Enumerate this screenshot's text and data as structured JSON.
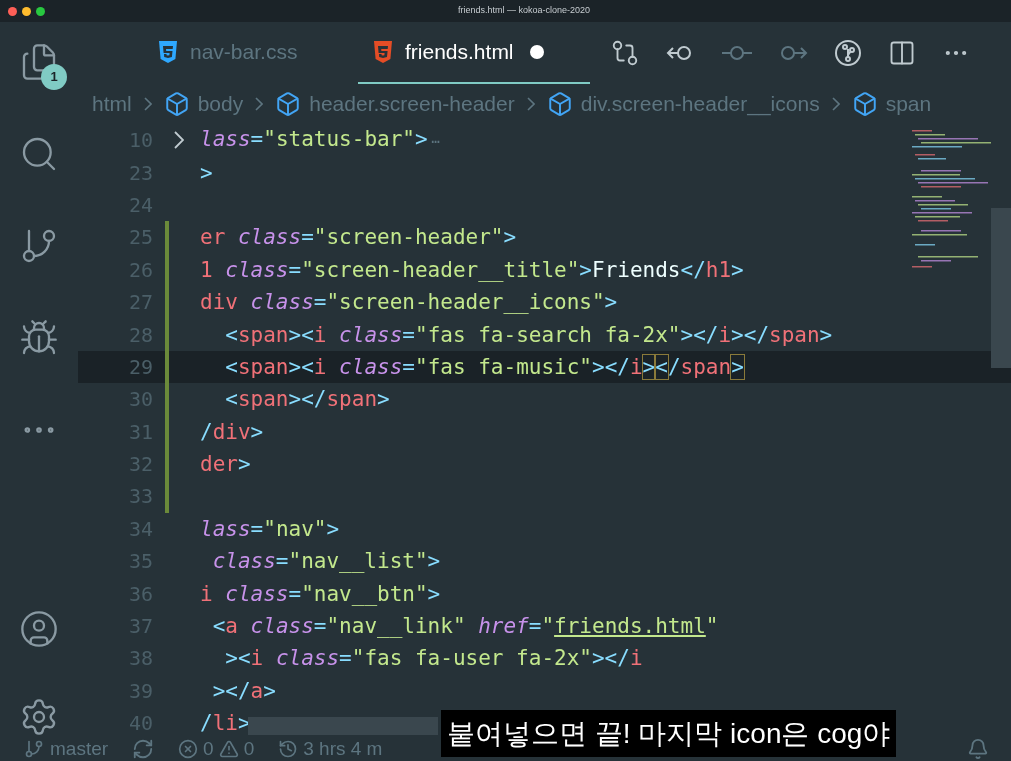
{
  "window": {
    "title": "friends.html — kokoa-clone-2020"
  },
  "activity_bar": {
    "items": [
      {
        "kind": "files",
        "badge": "1"
      },
      {
        "kind": "search"
      },
      {
        "kind": "git"
      },
      {
        "kind": "debug"
      },
      {
        "kind": "more"
      }
    ],
    "bottom": [
      {
        "kind": "account"
      },
      {
        "kind": "settings"
      }
    ]
  },
  "tabs": [
    {
      "label": "nav-bar.css",
      "kind": "css",
      "selected": false,
      "dirty": false
    },
    {
      "label": "friends.html",
      "kind": "html",
      "selected": true,
      "dirty": true
    }
  ],
  "breadcrumbs": [
    {
      "label": "html",
      "kind": "plain"
    },
    {
      "label": "body",
      "kind": "element"
    },
    {
      "label": "header.screen-header",
      "kind": "element"
    },
    {
      "label": "div.screen-header__icons",
      "kind": "element"
    },
    {
      "label": "span",
      "kind": "element"
    }
  ],
  "lines": [
    {
      "number": "10",
      "folded": true,
      "modified": false,
      "current": false,
      "tokens": [
        {
          "kind": "attr",
          "text": "lass"
        },
        {
          "kind": "punct",
          "text": "="
        },
        {
          "kind": "string",
          "text": "\"status-bar\""
        },
        {
          "kind": "punct",
          "text": ">"
        },
        {
          "kind": "ellipsis",
          "text": "⋯"
        }
      ]
    },
    {
      "number": "23",
      "folded": false,
      "modified": false,
      "current": false,
      "tokens": [
        {
          "kind": "punct",
          "text": ">"
        }
      ]
    },
    {
      "number": "24",
      "folded": false,
      "modified": false,
      "current": false
    },
    {
      "number": "25",
      "folded": false,
      "modified": true,
      "current": false,
      "tokens": [
        {
          "kind": "tag",
          "text": "er"
        },
        {
          "kind": "attr",
          "text": " class"
        },
        {
          "kind": "punct",
          "text": "="
        },
        {
          "kind": "string",
          "text": "\"screen-header\""
        },
        {
          "kind": "punct",
          "text": ">"
        }
      ]
    },
    {
      "number": "26",
      "folded": false,
      "modified": true,
      "current": false,
      "tokens": [
        {
          "kind": "tag",
          "text": "1"
        },
        {
          "kind": "attr",
          "text": " class"
        },
        {
          "kind": "punct",
          "text": "="
        },
        {
          "kind": "string",
          "text": "\"screen-header__title\""
        },
        {
          "kind": "punct",
          "text": ">"
        },
        {
          "kind": "text",
          "text": "Friends"
        },
        {
          "kind": "punct",
          "text": "</"
        },
        {
          "kind": "tag",
          "text": "h1"
        },
        {
          "kind": "punct",
          "text": ">"
        }
      ]
    },
    {
      "number": "27",
      "folded": false,
      "modified": true,
      "current": false,
      "tokens": [
        {
          "kind": "tag",
          "text": "div"
        },
        {
          "kind": "attr",
          "text": " class"
        },
        {
          "kind": "punct",
          "text": "="
        },
        {
          "kind": "string",
          "text": "\"screen-header__icons\""
        },
        {
          "kind": "punct",
          "text": ">"
        }
      ]
    },
    {
      "number": "28",
      "folded": false,
      "modified": true,
      "current": false,
      "tokens": [
        {
          "kind": "punct",
          "text": "  <"
        },
        {
          "kind": "tag",
          "text": "span"
        },
        {
          "kind": "punct",
          "text": "><"
        },
        {
          "kind": "tag",
          "text": "i"
        },
        {
          "kind": "attr",
          "text": " class"
        },
        {
          "kind": "punct",
          "text": "="
        },
        {
          "kind": "string",
          "text": "\"fas fa-search fa-2x\""
        },
        {
          "kind": "punct",
          "text": "></"
        },
        {
          "kind": "tag",
          "text": "i"
        },
        {
          "kind": "punct",
          "text": "></"
        },
        {
          "kind": "tag",
          "text": "span"
        },
        {
          "kind": "punct",
          "text": ">"
        }
      ]
    },
    {
      "number": "29",
      "folded": false,
      "modified": true,
      "current": true,
      "tokens": [
        {
          "kind": "punct",
          "text": "  <"
        },
        {
          "kind": "tag",
          "text": "span"
        },
        {
          "kind": "punct",
          "text": "><"
        },
        {
          "kind": "tag",
          "text": "i"
        },
        {
          "kind": "attr",
          "text": " class"
        },
        {
          "kind": "punct",
          "text": "="
        },
        {
          "kind": "string",
          "text": "\"fas fa-music\""
        },
        {
          "kind": "punct",
          "text": "></"
        },
        {
          "kind": "tag",
          "text": "i"
        },
        {
          "kind": "match",
          "text": ">"
        },
        {
          "kind": "match",
          "text": "<"
        },
        {
          "kind": "punct",
          "text": "/"
        },
        {
          "kind": "tag",
          "text": "span"
        },
        {
          "kind": "match",
          "text": ">"
        }
      ]
    },
    {
      "number": "30",
      "folded": false,
      "modified": true,
      "current": false,
      "tokens": [
        {
          "kind": "punct",
          "text": "  <"
        },
        {
          "kind": "tag",
          "text": "span"
        },
        {
          "kind": "punct",
          "text": "></"
        },
        {
          "kind": "tag",
          "text": "span"
        },
        {
          "kind": "punct",
          "text": ">"
        }
      ]
    },
    {
      "number": "31",
      "folded": false,
      "modified": true,
      "current": false,
      "tokens": [
        {
          "kind": "punct",
          "text": "/"
        },
        {
          "kind": "tag",
          "text": "div"
        },
        {
          "kind": "punct",
          "text": ">"
        }
      ]
    },
    {
      "number": "32",
      "folded": false,
      "modified": true,
      "current": false,
      "tokens": [
        {
          "kind": "tag",
          "text": "der"
        },
        {
          "kind": "punct",
          "text": ">"
        }
      ]
    },
    {
      "number": "33",
      "folded": false,
      "modified": true,
      "current": false
    },
    {
      "number": "34",
      "folded": false,
      "modified": false,
      "current": false,
      "tokens": [
        {
          "kind": "attr",
          "text": "lass"
        },
        {
          "kind": "punct",
          "text": "="
        },
        {
          "kind": "string",
          "text": "\"nav\""
        },
        {
          "kind": "punct",
          "text": ">"
        }
      ]
    },
    {
      "number": "35",
      "folded": false,
      "modified": false,
      "current": false,
      "tokens": [
        {
          "kind": "attr",
          "text": " class"
        },
        {
          "kind": "punct",
          "text": "="
        },
        {
          "kind": "string",
          "text": "\"nav__list\""
        },
        {
          "kind": "punct",
          "text": ">"
        }
      ]
    },
    {
      "number": "36",
      "folded": false,
      "modified": false,
      "current": false,
      "tokens": [
        {
          "kind": "tag",
          "text": "i"
        },
        {
          "kind": "attr",
          "text": " class"
        },
        {
          "kind": "punct",
          "text": "="
        },
        {
          "kind": "string",
          "text": "\"nav__btn\""
        },
        {
          "kind": "punct",
          "text": ">"
        }
      ]
    },
    {
      "number": "37",
      "folded": false,
      "modified": false,
      "current": false,
      "tokens": [
        {
          "kind": "punct",
          "text": " <"
        },
        {
          "kind": "tag",
          "text": "a"
        },
        {
          "kind": "attr",
          "text": " class"
        },
        {
          "kind": "punct",
          "text": "="
        },
        {
          "kind": "string",
          "text": "\"nav__link\""
        },
        {
          "kind": "attr",
          "text": " href"
        },
        {
          "kind": "punct",
          "text": "="
        },
        {
          "kind": "string",
          "text": "\""
        },
        {
          "kind": "link",
          "text": "friends.html"
        },
        {
          "kind": "string",
          "text": "\""
        }
      ]
    },
    {
      "number": "38",
      "folded": false,
      "modified": false,
      "current": false,
      "tokens": [
        {
          "kind": "punct",
          "text": "  ><"
        },
        {
          "kind": "tag",
          "text": "i"
        },
        {
          "kind": "attr",
          "text": " class"
        },
        {
          "kind": "punct",
          "text": "="
        },
        {
          "kind": "string",
          "text": "\"fas fa-user fa-2x\""
        },
        {
          "kind": "punct",
          "text": "></"
        },
        {
          "kind": "tag",
          "text": "i"
        }
      ]
    },
    {
      "number": "39",
      "folded": false,
      "modified": false,
      "current": false,
      "tokens": [
        {
          "kind": "punct",
          "text": " ></"
        },
        {
          "kind": "tag",
          "text": "a"
        },
        {
          "kind": "punct",
          "text": ">"
        }
      ]
    },
    {
      "number": "40",
      "folded": false,
      "modified": false,
      "current": false,
      "tokens": [
        {
          "kind": "punct",
          "text": "/"
        },
        {
          "kind": "tag",
          "text": "li"
        },
        {
          "kind": "punct",
          "text": ">"
        }
      ]
    }
  ],
  "status_bar": {
    "branch": "master",
    "errors": "0",
    "warnings": "0",
    "time": "3 hrs 4 m"
  },
  "subtitle": "붙여넣으면 끝! 마지막 icon은 cog야"
}
